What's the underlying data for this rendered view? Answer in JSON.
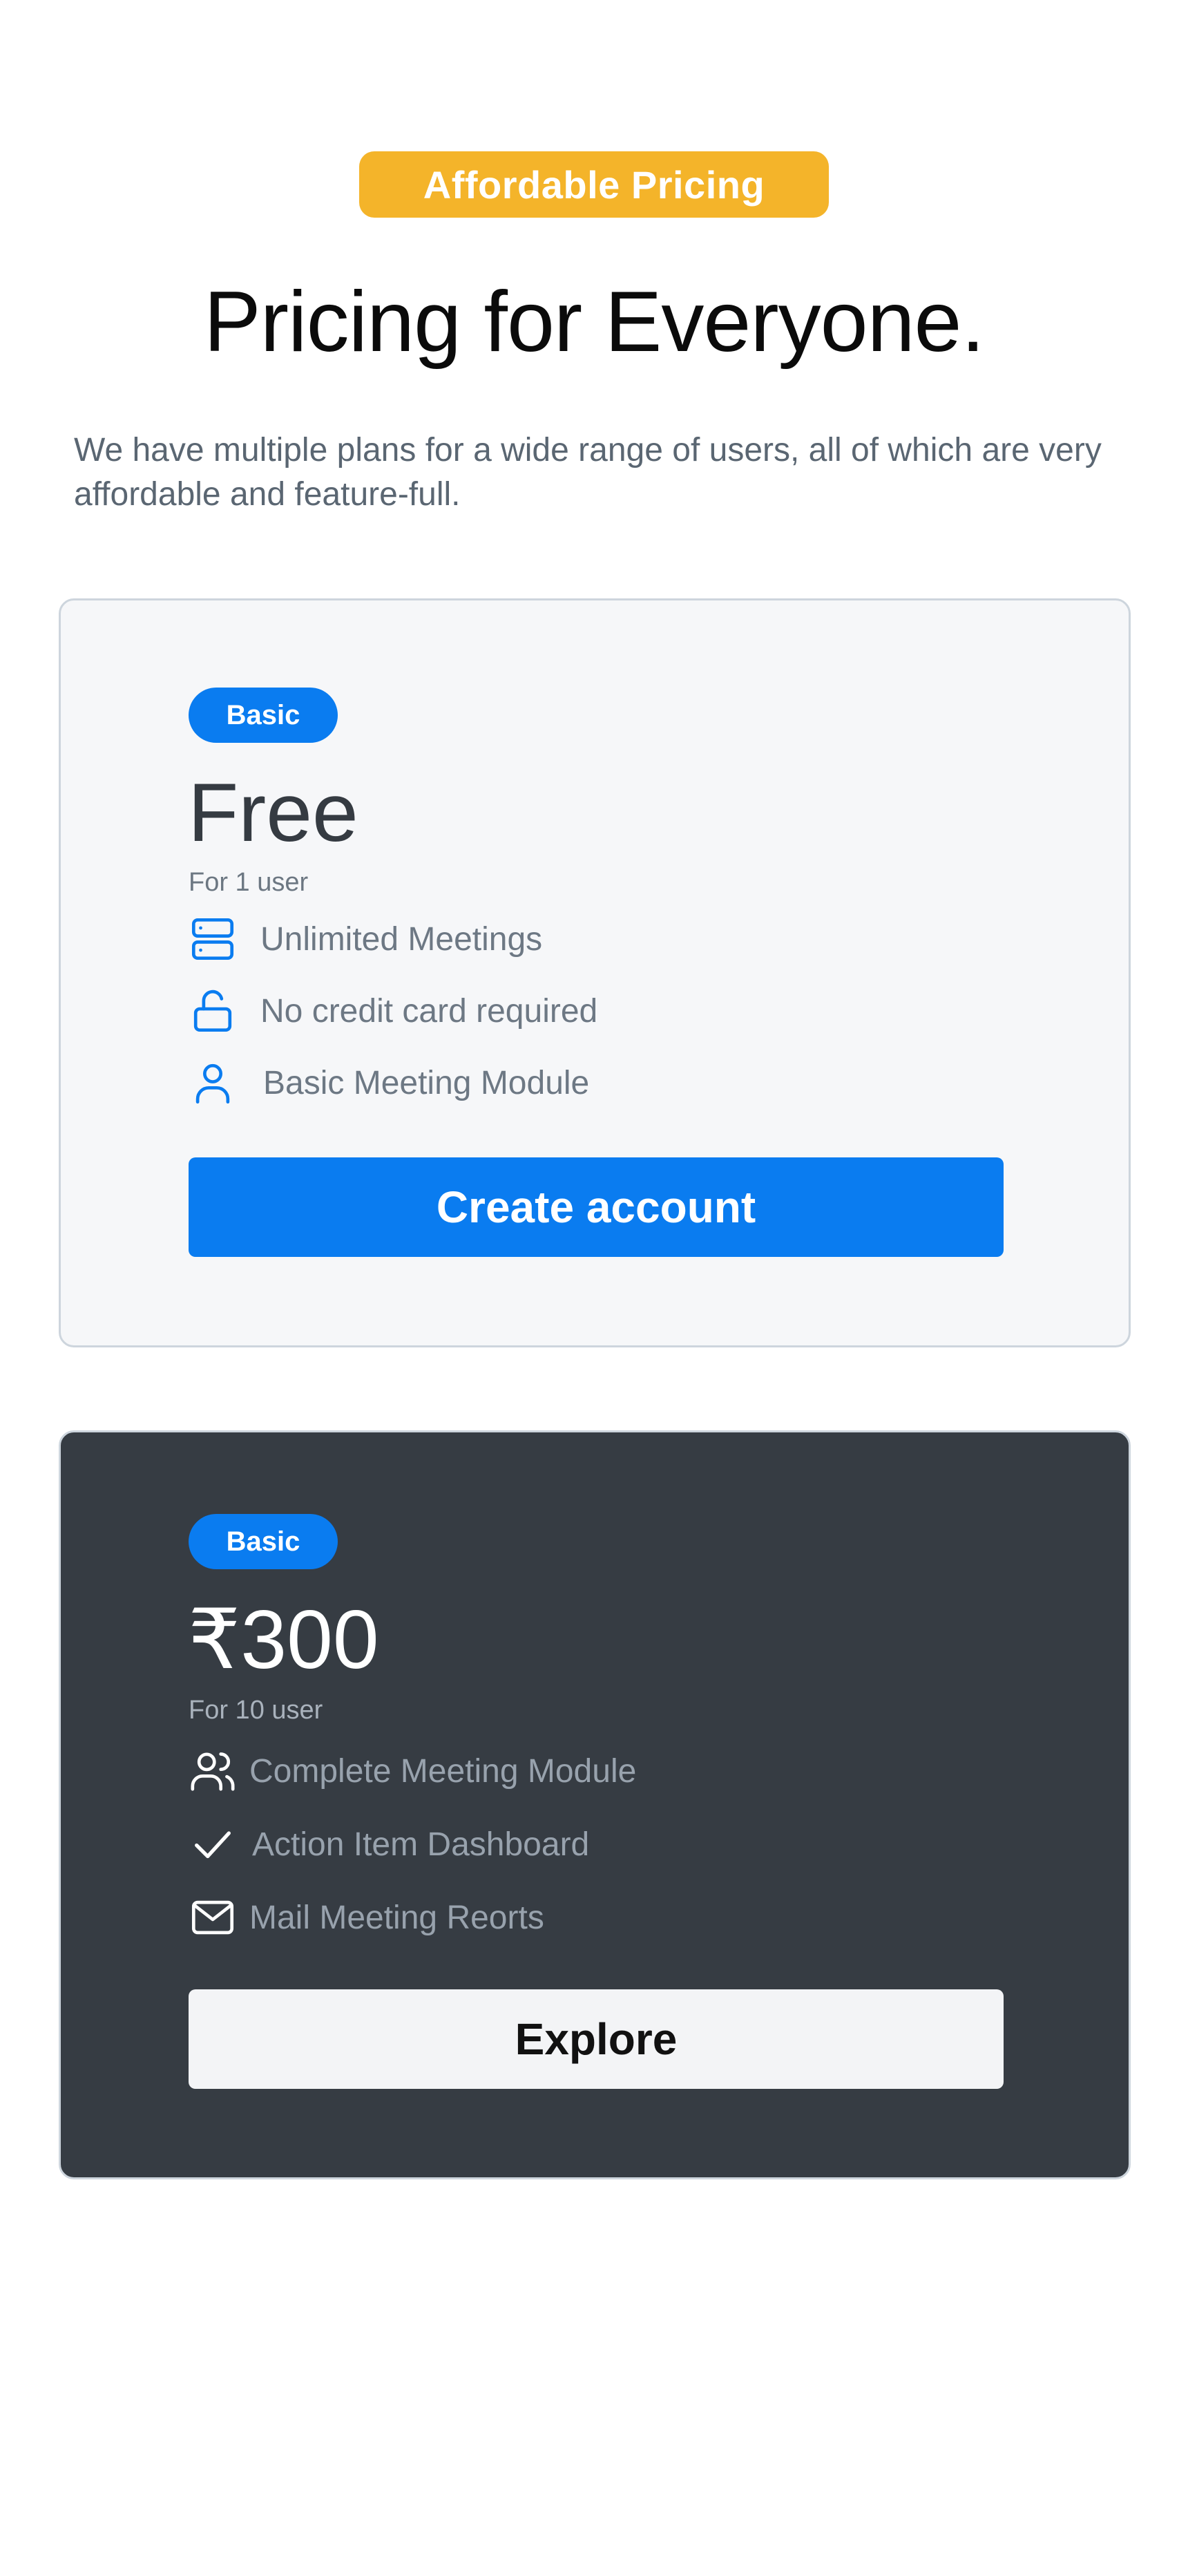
{
  "header": {
    "badge": "Affordable Pricing",
    "title": "Pricing for Everyone.",
    "subtitle": "We have multiple plans for a wide range of users, all of which are very affordable and feature-full."
  },
  "plans": [
    {
      "tag": "Basic",
      "price": "Free",
      "users": "For 1 user",
      "features": [
        {
          "icon": "server-icon",
          "label": "Unlimited Meetings"
        },
        {
          "icon": "unlock-icon",
          "label": "No credit card required"
        },
        {
          "icon": "user-icon",
          "label": "Basic Meeting Module"
        }
      ],
      "cta": "Create account"
    },
    {
      "tag": "Basic",
      "price": "₹300",
      "users": "For 10 user",
      "features": [
        {
          "icon": "users-icon",
          "label": "Complete Meeting Module"
        },
        {
          "icon": "check-icon",
          "label": "Action Item Dashboard"
        },
        {
          "icon": "mail-icon",
          "label": "Mail Meeting Reorts"
        }
      ],
      "cta": "Explore"
    }
  ],
  "colors": {
    "accent_yellow": "#f4b42a",
    "primary_blue": "#0a7cf0",
    "dark_card": "#363c43",
    "light_card": "#f6f7f9"
  }
}
